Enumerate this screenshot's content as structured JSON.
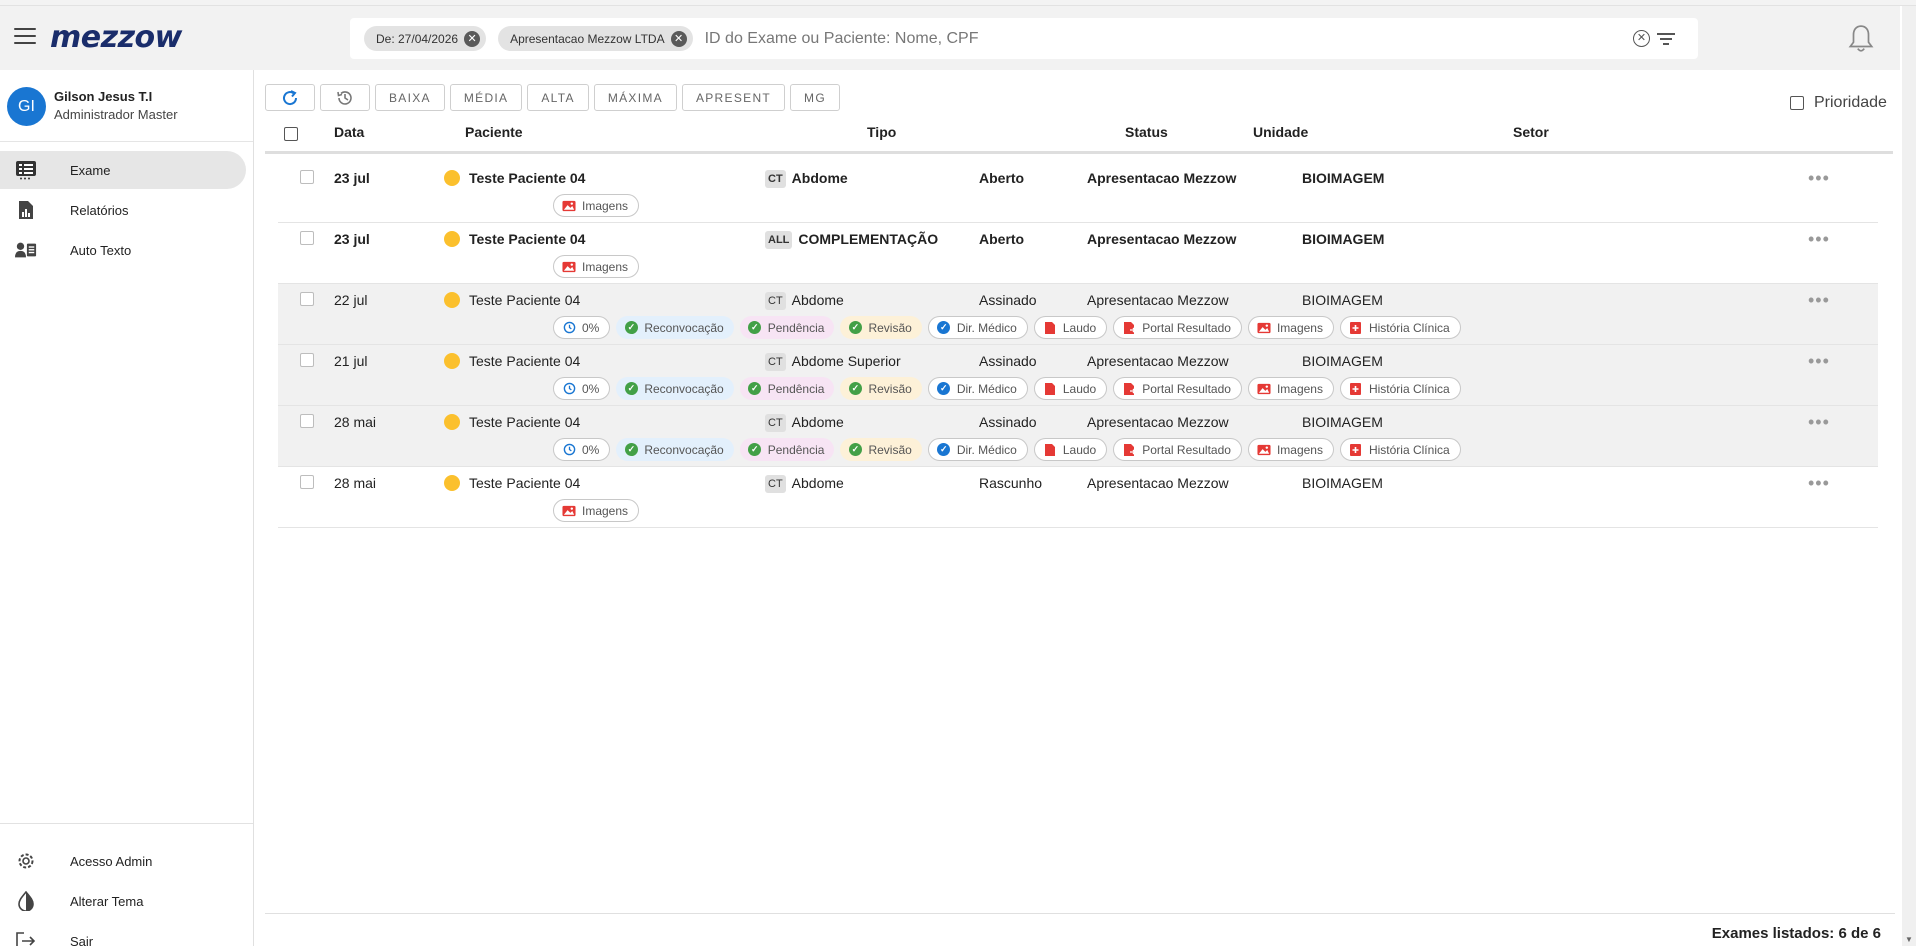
{
  "app": {
    "logo": "mezzow"
  },
  "search": {
    "chips": [
      {
        "label": "De: 27/04/2026"
      },
      {
        "label": "Apresentacao Mezzow LTDA"
      }
    ],
    "placeholder": "ID do Exame ou Paciente: Nome, CPF"
  },
  "user": {
    "initials": "GI",
    "name": "Gilson Jesus T.I",
    "role": "Administrador Master"
  },
  "nav": {
    "main": [
      {
        "label": "Exame",
        "icon": "exam-list-icon",
        "active": true
      },
      {
        "label": "Relatórios",
        "icon": "report-icon",
        "active": false
      },
      {
        "label": "Auto Texto",
        "icon": "auto-text-icon",
        "active": false
      }
    ],
    "bottom": [
      {
        "label": "Acesso Admin",
        "icon": "gear-icon"
      },
      {
        "label": "Alterar Tema",
        "icon": "theme-icon"
      },
      {
        "label": "Sair",
        "icon": "logout-icon"
      }
    ]
  },
  "toolbar": {
    "buttons": [
      "BAIXA",
      "MÉDIA",
      "ALTA",
      "MÁXIMA",
      "APRESENT",
      "MG"
    ],
    "priority_label": "Prioridade"
  },
  "table": {
    "headers": {
      "data": "Data",
      "paciente": "Paciente",
      "tipo": "Tipo",
      "status": "Status",
      "unidade": "Unidade",
      "setor": "Setor"
    },
    "rows": [
      {
        "date": "23 jul",
        "patient": "Teste Paciente 04",
        "modality": "CT",
        "type": "Abdome",
        "status": "Aberto",
        "unit": "Apresentacao Mezzow",
        "sector": "BIOIMAGEM",
        "bold": true,
        "grey": false,
        "tags": [
          "Imagens"
        ]
      },
      {
        "date": "23 jul",
        "patient": "Teste Paciente 04",
        "modality": "ALL",
        "type": "COMPLEMENTAÇÃO",
        "status": "Aberto",
        "unit": "Apresentacao Mezzow",
        "sector": "BIOIMAGEM",
        "bold": true,
        "grey": false,
        "tags": [
          "Imagens"
        ]
      },
      {
        "date": "22 jul",
        "patient": "Teste Paciente 04",
        "modality": "CT",
        "type": "Abdome",
        "status": "Assinado",
        "unit": "Apresentacao Mezzow",
        "sector": "BIOIMAGEM",
        "bold": false,
        "grey": true,
        "tags": [
          "0%",
          "Reconvocação",
          "Pendência",
          "Revisão",
          "Dir. Médico",
          "Laudo",
          "Portal Resultado",
          "Imagens",
          "História Clínica"
        ]
      },
      {
        "date": "21 jul",
        "patient": "Teste Paciente 04",
        "modality": "CT",
        "type": "Abdome Superior",
        "status": "Assinado",
        "unit": "Apresentacao Mezzow",
        "sector": "BIOIMAGEM",
        "bold": false,
        "grey": true,
        "tags": [
          "0%",
          "Reconvocação",
          "Pendência",
          "Revisão",
          "Dir. Médico",
          "Laudo",
          "Portal Resultado",
          "Imagens",
          "História Clínica"
        ]
      },
      {
        "date": "28 mai",
        "patient": "Teste Paciente 04",
        "modality": "CT",
        "type": "Abdome",
        "status": "Assinado",
        "unit": "Apresentacao Mezzow",
        "sector": "BIOIMAGEM",
        "bold": false,
        "grey": true,
        "tags": [
          "0%",
          "Reconvocação",
          "Pendência",
          "Revisão",
          "Dir. Médico",
          "Laudo",
          "Portal Resultado",
          "Imagens",
          "História Clínica"
        ]
      },
      {
        "date": "28 mai",
        "patient": "Teste Paciente 04",
        "modality": "CT",
        "type": "Abdome",
        "status": "Rascunho",
        "unit": "Apresentacao Mezzow",
        "sector": "BIOIMAGEM",
        "bold": false,
        "grey": false,
        "tags": [
          "Imagens"
        ]
      }
    ]
  },
  "footer": {
    "count_label": "Exames listados: 6 de 6"
  },
  "colors": {
    "primary": "#1976d2",
    "logo": "#1a2d6b",
    "dot": "#fbc02d",
    "red": "#e53935",
    "green": "#43a047"
  }
}
